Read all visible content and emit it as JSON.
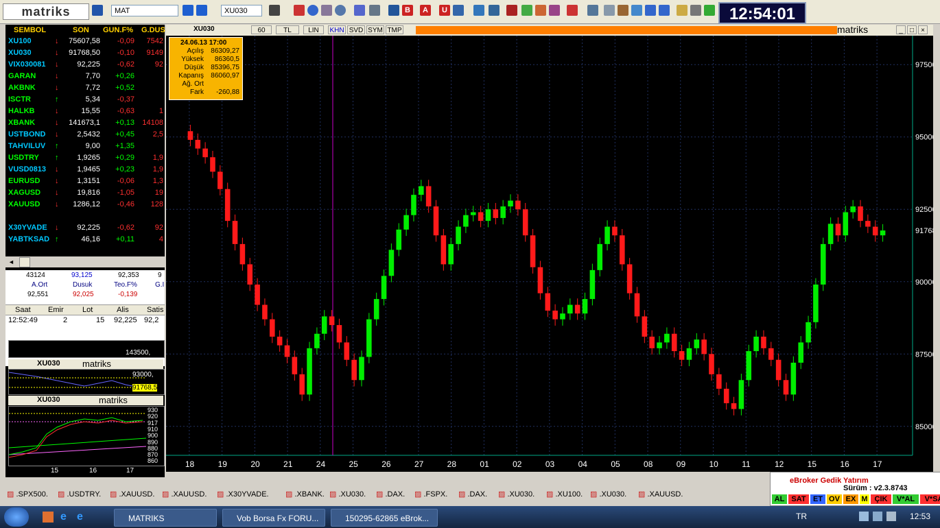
{
  "toolbar": {
    "logo": "matriks",
    "box1": "MAT",
    "box2": "XU030",
    "clock": "12:54:01"
  },
  "watchlist": {
    "headers": [
      "SEMBOL",
      "SON",
      "GUN.F%",
      "G.DUS"
    ],
    "rows": [
      {
        "sym": "XU100",
        "color": "#00c8ff",
        "arrow": "↓",
        "son": "75607,58",
        "chg": "-0,09",
        "gdus": "7542"
      },
      {
        "sym": "XU030",
        "color": "#00c8ff",
        "arrow": "↓",
        "son": "91768,50",
        "chg": "-0,10",
        "gdus": "9149"
      },
      {
        "sym": "VIX030081",
        "color": "#00c8ff",
        "arrow": "↓",
        "son": "92,225",
        "chg": "-0,62",
        "gdus": "92"
      },
      {
        "sym": "GARAN",
        "color": "#00ff00",
        "arrow": "↓",
        "son": "7,70",
        "chg": "+0,26",
        "gdus": ""
      },
      {
        "sym": "AKBNK",
        "color": "#00ff00",
        "arrow": "↓",
        "son": "7,72",
        "chg": "+0,52",
        "gdus": ""
      },
      {
        "sym": "ISCTR",
        "color": "#00ff00",
        "arrow": "↑",
        "son": "5,34",
        "chg": "-0,37",
        "gdus": ""
      },
      {
        "sym": "HALKB",
        "color": "#00ff00",
        "arrow": "↓",
        "son": "15,55",
        "chg": "-0,63",
        "gdus": "1"
      },
      {
        "sym": "XBANK",
        "color": "#00ff00",
        "arrow": "↓",
        "son": "141673,1",
        "chg": "+0,13",
        "gdus": "14108"
      },
      {
        "sym": "USTBOND",
        "color": "#00c8ff",
        "arrow": "↓",
        "son": "2,5432",
        "chg": "+0,45",
        "gdus": "2,5"
      },
      {
        "sym": "TAHVILUV",
        "color": "#00c8ff",
        "arrow": "↑",
        "son": "9,00",
        "chg": "+1,35",
        "gdus": ""
      },
      {
        "sym": "USDTRY",
        "color": "#00ff00",
        "arrow": "↑",
        "son": "1,9265",
        "chg": "+0,29",
        "gdus": "1,9"
      },
      {
        "sym": "VUSD0813",
        "color": "#00c8ff",
        "arrow": "↓",
        "son": "1,9465",
        "chg": "+0,23",
        "gdus": "1,9"
      },
      {
        "sym": "EURUSD",
        "color": "#00ff00",
        "arrow": "↓",
        "son": "1,3151",
        "chg": "-0,06",
        "gdus": "1,3"
      },
      {
        "sym": "XAGUSD",
        "color": "#00ff00",
        "arrow": "↓",
        "son": "19,816",
        "chg": "-1,05",
        "gdus": "19"
      },
      {
        "sym": "XAUUSD",
        "color": "#00ff00",
        "arrow": "↓",
        "son": "1286,12",
        "chg": "-0,46",
        "gdus": "128"
      },
      {
        "sym": "",
        "color": "#000",
        "arrow": "",
        "son": "",
        "chg": "",
        "gdus": ""
      },
      {
        "sym": "X30YVADE",
        "color": "#00c8ff",
        "arrow": "↓",
        "son": "92,225",
        "chg": "-0,62",
        "gdus": "92"
      },
      {
        "sym": "YABTKSAD",
        "color": "#00c8ff",
        "arrow": "↑",
        "son": "46,16",
        "chg": "+0,11",
        "gdus": "4"
      }
    ]
  },
  "info": {
    "r1": [
      "43124",
      "93,125",
      "92,353",
      "9"
    ],
    "r2": [
      "A.Ort",
      "Dusuk",
      "Teo.F%",
      "G.I"
    ],
    "r3": [
      "92,551",
      "92,025",
      "-0,139",
      ""
    ],
    "trade_headers": [
      "Saat",
      "Emir",
      "Lot",
      "Alis",
      "Satis"
    ],
    "trade_row": [
      "12:52:49",
      "2",
      "15",
      "92,225",
      "92,2"
    ]
  },
  "mini1": {
    "title": "XU030",
    "brand": "matriks",
    "price1": "93000,",
    "price2": "91768,5",
    "top": "143500,"
  },
  "mini2": {
    "title": "XU030",
    "brand": "matriks",
    "ticks": [
      "930",
      "920",
      "917",
      "910",
      "900",
      "890",
      "880",
      "870",
      "860"
    ],
    "xlabels": [
      "15",
      "16",
      "17"
    ]
  },
  "chart": {
    "symbol": "XU030",
    "period": "60",
    "buttons": [
      "TL",
      "LIN",
      "KHN",
      "SVD",
      "SYM",
      "TMP"
    ],
    "brand": "matriks",
    "tooltip": {
      "date": "24.06.13 17:00",
      "rows": [
        [
          "Açılış",
          "86309,27"
        ],
        [
          "Yüksek",
          "86360,5"
        ],
        [
          "Düşük",
          "85396,75"
        ],
        [
          "Kapanış",
          "86060,97"
        ],
        [
          "Ağ. Ort",
          ""
        ],
        [
          "Fark",
          "-260,88"
        ]
      ]
    },
    "price_labels": [
      "97500,",
      "95000,",
      "92500,",
      "90000,",
      "87500,",
      "85000,"
    ],
    "last_price": "91768,5",
    "dates": [
      "18",
      "19",
      "20",
      "21",
      "24",
      "25",
      "26",
      "27",
      "28",
      "01",
      "02",
      "03",
      "04",
      "05",
      "08",
      "09",
      "10",
      "11",
      "12",
      "15",
      "16",
      "17"
    ]
  },
  "chart_data": {
    "type": "candlestick",
    "symbol": "XU030",
    "interval": "60",
    "ylim": [
      84000,
      98500
    ],
    "y_ticks": [
      85000,
      87500,
      90000,
      92500,
      95000,
      97500
    ],
    "x_ticks": [
      "18",
      "19",
      "20",
      "21",
      "24",
      "25",
      "26",
      "27",
      "28",
      "01",
      "02",
      "03",
      "04",
      "05",
      "08",
      "09",
      "10",
      "11",
      "12",
      "15",
      "16",
      "17"
    ],
    "last": 91768.5,
    "closes": [
      94900,
      94600,
      94300,
      93800,
      93200,
      92100,
      91300,
      90600,
      89900,
      89200,
      88700,
      88100,
      87800,
      87400,
      86800,
      86100,
      87700,
      88200,
      88800,
      88500,
      87900,
      87300,
      86600,
      87400,
      88700,
      89400,
      90200,
      91100,
      91800,
      92300,
      93000,
      93300,
      92600,
      91600,
      90600,
      91300,
      91900,
      92300,
      92400,
      92100,
      92500,
      92200,
      92600,
      92800,
      92500,
      91600,
      90500,
      89600,
      89000,
      88700,
      88900,
      89200,
      88900,
      89400,
      90400,
      91300,
      91900,
      91600,
      90600,
      89600,
      88800,
      88100,
      87700,
      87900,
      88200,
      87600,
      87300,
      87700,
      88000,
      87500,
      86800,
      86300,
      85800,
      85600,
      86600,
      87600,
      88100,
      87700,
      87300,
      86600,
      86100,
      87200,
      87900,
      88600,
      89900,
      91300,
      92000,
      91600,
      92400,
      92600,
      92100,
      91900,
      91600,
      91768
    ]
  },
  "taskbar_tabs": [
    ".SPX500.",
    ".USDTRY.",
    ".XAUUSD.",
    ".XAUUSD.",
    ".X30YVADE.",
    ".XBANK.",
    ".XU030.",
    ".DAX.",
    ".FSPX.",
    ".DAX.",
    ".XU030.",
    ".XU100.",
    ".XU030.",
    ".XAUUSD."
  ],
  "ebroker": {
    "title": "eBroker Gedik Yatırım",
    "version": "Sürüm : v2.3.8743",
    "buttons": [
      "AL",
      "SAT",
      "ET",
      "OV",
      "EX",
      "M",
      "ÇIK",
      "V*AL",
      "V*SAT"
    ]
  },
  "taskbar": {
    "items": [
      "MATRIKS",
      "Vob Borsa Fx FORU...",
      "150295-62865 eBrok..."
    ],
    "lang": "TR",
    "time": "12:53"
  }
}
